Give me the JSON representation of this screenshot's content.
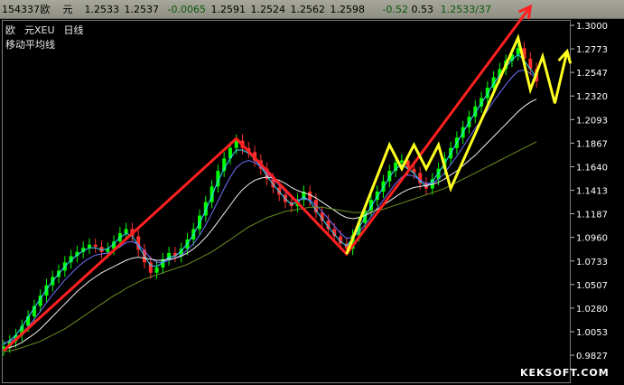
{
  "quote_bar": {
    "fields": [
      "154337",
      "欧",
      "元",
      "1.2533",
      "1.2537",
      "-0.0065",
      "1.2591",
      "1.2524",
      "1.2562",
      "1.2598",
      "-0.52",
      "0.53",
      "1.2533/37"
    ]
  },
  "header": {
    "title_parts": [
      "欧",
      "元XEU",
      "日线"
    ],
    "subtitle": "移动平均线"
  },
  "watermark": "KEKSOFT.COM",
  "colors": {
    "background": "#000000",
    "candle_up": "#00ff00",
    "candle_down": "#ff3030",
    "trend_red": "#ff2020",
    "trend_yellow": "#ffff20",
    "ma_short": "#30e0ff",
    "ma_mid": "#7070ff",
    "ma_long": "#f0f0f0",
    "ma_longest": "#6b8e23"
  },
  "chart_data": {
    "type": "line",
    "title": "",
    "xlabel": "",
    "ylabel": "",
    "ylim": [
      0.9827,
      1.3
    ],
    "yticks": [
      "1.3000",
      "1.2773",
      "1.2547",
      "1.2320",
      "1.2093",
      "1.1867",
      "1.1640",
      "1.1413",
      "1.1187",
      "1.0960",
      "1.0733",
      "1.0507",
      "1.0280",
      "1.0053",
      "0.9827"
    ],
    "price": [
      0.991,
      0.996,
      1.002,
      1.011,
      1.02,
      1.03,
      1.04,
      1.05,
      1.058,
      1.064,
      1.072,
      1.078,
      1.082,
      1.086,
      1.089,
      1.087,
      1.082,
      1.085,
      1.092,
      1.1,
      1.104,
      1.097,
      1.084,
      1.072,
      1.062,
      1.067,
      1.075,
      1.081,
      1.078,
      1.085,
      1.094,
      1.104,
      1.117,
      1.13,
      1.145,
      1.16,
      1.172,
      1.182,
      1.189,
      1.182,
      1.178,
      1.17,
      1.162,
      1.152,
      1.144,
      1.137,
      1.13,
      1.126,
      1.132,
      1.14,
      1.132,
      1.12,
      1.112,
      1.104,
      1.097,
      1.09,
      1.085,
      1.098,
      1.11,
      1.122,
      1.132,
      1.14,
      1.15,
      1.16,
      1.168,
      1.17,
      1.162,
      1.158,
      1.148,
      1.143,
      1.152,
      1.162,
      1.172,
      1.182,
      1.192,
      1.202,
      1.212,
      1.222,
      1.23,
      1.24,
      1.25,
      1.258,
      1.266,
      1.272,
      1.278,
      1.268,
      1.258,
      1.246
    ],
    "series": [
      {
        "values": [
          0.993,
          0.997,
          1.002,
          1.01,
          1.019,
          1.028,
          1.037,
          1.046,
          1.054,
          1.061,
          1.068,
          1.074,
          1.079,
          1.083,
          1.086,
          1.086,
          1.084,
          1.085,
          1.09,
          1.096,
          1.1,
          1.097,
          1.088,
          1.078,
          1.069,
          1.068,
          1.072,
          1.077,
          1.078,
          1.083,
          1.09,
          1.099,
          1.11,
          1.122,
          1.136,
          1.15,
          1.162,
          1.172,
          1.18,
          1.18,
          1.177,
          1.171,
          1.164,
          1.155,
          1.147,
          1.14,
          1.133,
          1.128,
          1.13,
          1.135,
          1.131,
          1.122,
          1.114,
          1.106,
          1.099,
          1.092,
          1.088,
          1.095,
          1.105,
          1.116,
          1.126,
          1.135,
          1.144,
          1.154,
          1.162,
          1.166,
          1.162,
          1.158,
          1.15,
          1.145,
          1.15,
          1.158,
          1.167,
          1.177,
          1.187,
          1.197,
          1.207,
          1.216,
          1.225,
          1.234,
          1.244,
          1.252,
          1.26,
          1.267,
          1.272,
          1.266,
          1.258,
          1.25
        ]
      },
      {
        "values": [
          0.994,
          0.996,
          0.999,
          1.004,
          1.01,
          1.017,
          1.025,
          1.033,
          1.041,
          1.048,
          1.055,
          1.061,
          1.067,
          1.072,
          1.076,
          1.079,
          1.08,
          1.081,
          1.083,
          1.087,
          1.091,
          1.092,
          1.089,
          1.083,
          1.076,
          1.072,
          1.072,
          1.074,
          1.076,
          1.079,
          1.084,
          1.09,
          1.098,
          1.108,
          1.119,
          1.131,
          1.143,
          1.154,
          1.163,
          1.168,
          1.17,
          1.168,
          1.164,
          1.158,
          1.152,
          1.146,
          1.14,
          1.134,
          1.132,
          1.133,
          1.132,
          1.127,
          1.121,
          1.114,
          1.107,
          1.1,
          1.095,
          1.096,
          1.101,
          1.108,
          1.116,
          1.124,
          1.132,
          1.14,
          1.148,
          1.154,
          1.156,
          1.155,
          1.151,
          1.148,
          1.148,
          1.152,
          1.158,
          1.166,
          1.174,
          1.183,
          1.192,
          1.201,
          1.209,
          1.218,
          1.227,
          1.235,
          1.243,
          1.25,
          1.256,
          1.257,
          1.254,
          1.249
        ]
      },
      {
        "values": [
          0.988,
          0.99,
          0.992,
          0.995,
          0.999,
          1.003,
          1.008,
          1.014,
          1.02,
          1.026,
          1.032,
          1.038,
          1.044,
          1.049,
          1.054,
          1.058,
          1.062,
          1.065,
          1.068,
          1.071,
          1.074,
          1.076,
          1.077,
          1.076,
          1.075,
          1.074,
          1.074,
          1.075,
          1.076,
          1.078,
          1.081,
          1.085,
          1.09,
          1.096,
          1.103,
          1.111,
          1.119,
          1.127,
          1.135,
          1.142,
          1.147,
          1.151,
          1.153,
          1.154,
          1.153,
          1.151,
          1.148,
          1.144,
          1.141,
          1.139,
          1.137,
          1.134,
          1.13,
          1.126,
          1.122,
          1.118,
          1.115,
          1.114,
          1.115,
          1.117,
          1.12,
          1.123,
          1.127,
          1.131,
          1.135,
          1.139,
          1.142,
          1.144,
          1.145,
          1.146,
          1.147,
          1.149,
          1.152,
          1.156,
          1.16,
          1.165,
          1.17,
          1.175,
          1.181,
          1.187,
          1.193,
          1.199,
          1.205,
          1.211,
          1.217,
          1.222,
          1.226,
          1.229
        ]
      },
      {
        "values": [
          0.986,
          0.987,
          0.988,
          0.99,
          0.992,
          0.994,
          0.996,
          0.999,
          1.002,
          1.005,
          1.008,
          1.012,
          1.016,
          1.02,
          1.024,
          1.028,
          1.032,
          1.036,
          1.04,
          1.043,
          1.047,
          1.05,
          1.053,
          1.056,
          1.058,
          1.06,
          1.062,
          1.064,
          1.066,
          1.068,
          1.07,
          1.073,
          1.076,
          1.079,
          1.082,
          1.086,
          1.09,
          1.094,
          1.098,
          1.102,
          1.106,
          1.109,
          1.112,
          1.115,
          1.117,
          1.119,
          1.121,
          1.122,
          1.123,
          1.124,
          1.125,
          1.125,
          1.125,
          1.124,
          1.123,
          1.122,
          1.121,
          1.12,
          1.12,
          1.12,
          1.121,
          1.122,
          1.123,
          1.125,
          1.127,
          1.129,
          1.131,
          1.133,
          1.135,
          1.137,
          1.139,
          1.141,
          1.143,
          1.146,
          1.149,
          1.152,
          1.155,
          1.158,
          1.161,
          1.164,
          1.167,
          1.17,
          1.173,
          1.176,
          1.179,
          1.182,
          1.185,
          1.188
        ]
      }
    ],
    "trendlines": [
      {
        "color": "red",
        "points": [
          [
            0,
            0.987
          ],
          [
            38,
            1.191
          ],
          [
            56,
            1.08
          ],
          [
            86,
            1.318
          ]
        ]
      },
      {
        "color": "yellow",
        "points": [
          [
            56,
            1.08
          ],
          [
            63,
            1.185
          ],
          [
            65,
            1.162
          ],
          [
            67,
            1.185
          ],
          [
            69,
            1.162
          ],
          [
            71,
            1.185
          ],
          [
            73,
            1.143
          ],
          [
            84,
            1.288
          ],
          [
            86,
            1.238
          ],
          [
            88,
            1.27
          ],
          [
            90,
            1.225
          ],
          [
            92,
            1.275
          ]
        ]
      }
    ],
    "grid": false,
    "legend": "none"
  }
}
